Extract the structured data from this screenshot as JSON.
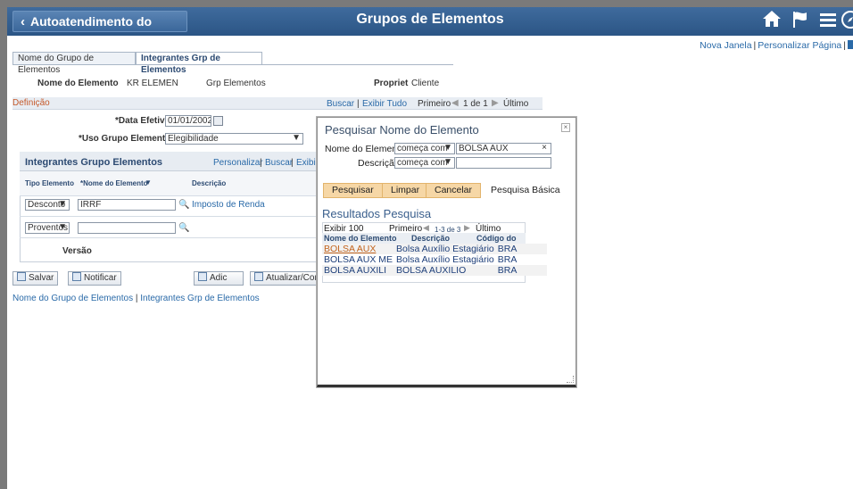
{
  "banner": {
    "back_label": "Autoatendimento do Gerente",
    "title": "Grupos de Elementos",
    "icons": [
      "home-icon",
      "flag-icon",
      "menu-icon",
      "compass-icon"
    ]
  },
  "topnav": {
    "new_window": "Nova Janela",
    "personalize_page": "Personalizar Página"
  },
  "tabs": [
    "Nome do Grupo de Elementos",
    "Integrantes Grp de Elementos"
  ],
  "header": {
    "element_name_label": "Nome do Elemento",
    "element_name_value": "KR ELEMEN",
    "group_label": "Grp Elementos",
    "owner_label": "Propriet",
    "owner_value": "Cliente"
  },
  "definition": {
    "title": "Definição",
    "nav": {
      "find": "Buscar",
      "view_all": "Exibir Tudo",
      "first": "Primeiro",
      "range": "1 de 1",
      "last": "Último"
    },
    "effdt_label": "*Data Efetiva",
    "effdt_value": "01/01/2002",
    "usage_label": "*Uso Grupo Elementos",
    "usage_value": "Elegibilidade"
  },
  "members_grid": {
    "title": "Integrantes Grupo Elementos",
    "personalize": "Personalizar",
    "find": "Buscar",
    "view_all": "Exibi",
    "columns": [
      "Tipo Elemento",
      "*Nome do Elemento",
      "Descrição"
    ],
    "rows": [
      {
        "type": "Desconto",
        "name": "IRRF",
        "description": "Imposto de Renda"
      },
      {
        "type": "Proventos",
        "name": "",
        "description": ""
      }
    ],
    "version_label": "Versão"
  },
  "toolbar": {
    "save": "Salvar",
    "notify": "Notificar",
    "add": "Adic",
    "update": "Atualizar/Con"
  },
  "bottom_links": {
    "tab1": "Nome do Grupo de Elementos",
    "tab2": "Integrantes Grp de Elementos"
  },
  "modal": {
    "title": "Pesquisar Nome do Elemento",
    "field1_label": "Nome do Elemento",
    "field1_operator": "começa com",
    "field1_value": "BOLSA AUX",
    "field2_label": "Descrição",
    "field2_operator": "começa com",
    "field2_value": "",
    "search_btn": "Pesquisar",
    "clear_btn": "Limpar",
    "cancel_btn": "Cancelar",
    "basic_search": "Pesquisa Básica",
    "results_title": "Resultados Pesquisa",
    "show_100": "Exibir 100",
    "first": "Primeiro",
    "range": "1-3 de 3",
    "last": "Último",
    "columns": [
      "Nome do Elemento",
      "Descrição",
      "Código do País"
    ],
    "rows": [
      {
        "name": "BOLSA AUX",
        "description": "Bolsa Auxílio Estagiário",
        "country": "BRA"
      },
      {
        "name": "BOLSA AUX ME",
        "description": "Bolsa Auxílio Estagiário",
        "country": "BRA"
      },
      {
        "name": "BOLSA AUXILI",
        "description": "BOLSA AUXILIO",
        "country": "BRA"
      }
    ]
  }
}
